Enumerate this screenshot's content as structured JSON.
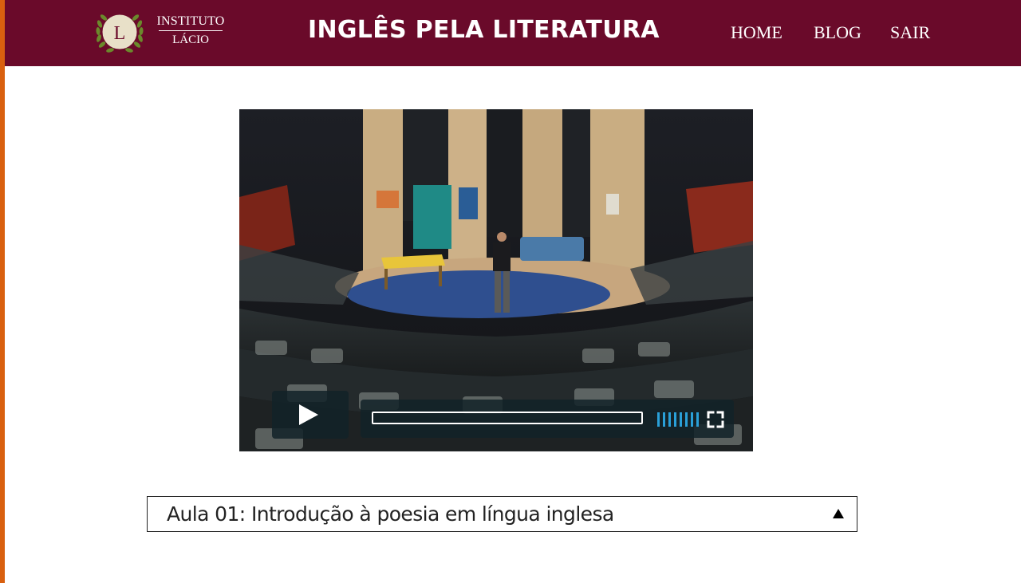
{
  "header": {
    "logo": {
      "initial": "L",
      "line1": "INSTITUTO",
      "line2": "LÁCIO"
    },
    "site_title": "INGLÊS PELA LITERATURA",
    "nav": [
      {
        "label": "HOME"
      },
      {
        "label": "BLOG"
      },
      {
        "label": "SAIR"
      }
    ]
  },
  "video": {
    "progress": 0,
    "volume_level": 1.0,
    "icons": [
      "play-icon",
      "volume-icon",
      "fullscreen-icon"
    ]
  },
  "lesson": {
    "title": "Aula 01: Introdução à poesia em língua inglesa",
    "expand_icon": "triangle-up-icon"
  },
  "colors": {
    "header_bg": "#6a0a2a",
    "left_accent": "#d9600f",
    "player_accent": "#2aa0d8"
  }
}
